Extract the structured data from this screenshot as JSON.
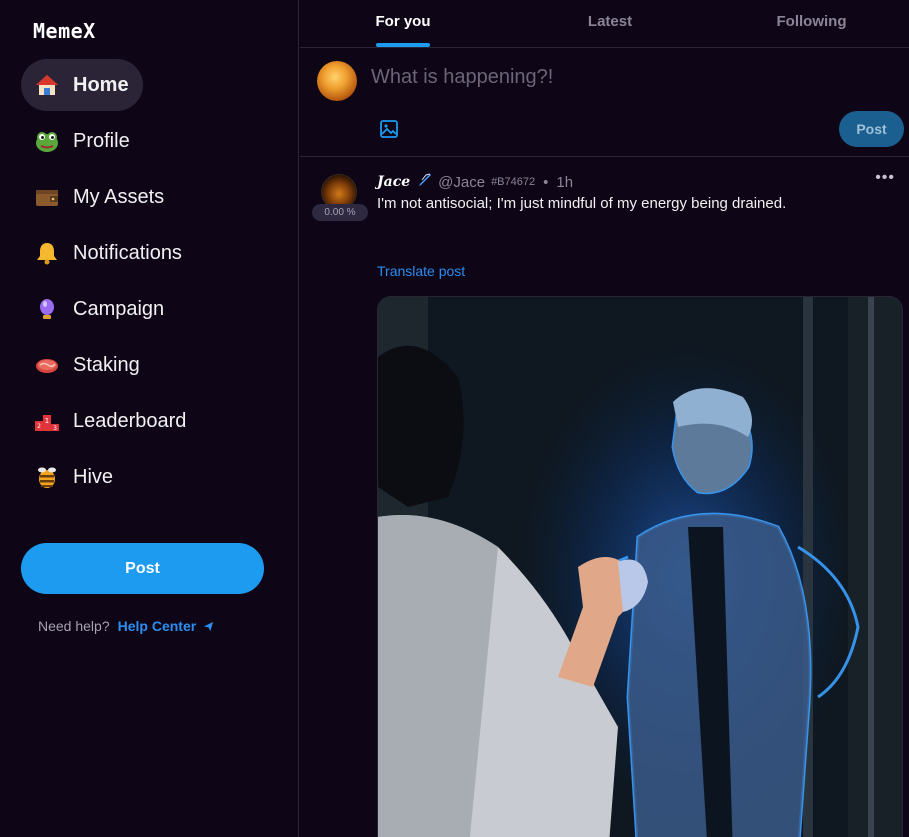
{
  "app": {
    "logo": "MemeX"
  },
  "sidebar": {
    "items": [
      {
        "label": "Home",
        "icon": "house-icon",
        "active": true
      },
      {
        "label": "Profile",
        "icon": "frog-icon"
      },
      {
        "label": "My Assets",
        "icon": "wallet-icon"
      },
      {
        "label": "Notifications",
        "icon": "bell-icon"
      },
      {
        "label": "Campaign",
        "icon": "crystal-icon"
      },
      {
        "label": "Staking",
        "icon": "steak-icon"
      },
      {
        "label": "Leaderboard",
        "icon": "podium-icon"
      },
      {
        "label": "Hive",
        "icon": "bee-icon"
      }
    ],
    "post_label": "Post",
    "help_question": "Need help?",
    "help_link": "Help Center"
  },
  "tabs": [
    {
      "label": "For you",
      "active": true
    },
    {
      "label": "Latest"
    },
    {
      "label": "Following"
    }
  ],
  "composer": {
    "placeholder": "What is happening?!",
    "post_label": "Post"
  },
  "post": {
    "name": "Jace",
    "handle": "@Jace",
    "hash": "#B74672",
    "separator": "•",
    "time": "1h",
    "percent": "0.00 %",
    "text": "I'm not antisocial; I'm just mindful of my energy being drained.",
    "translate_label": "Translate post",
    "more_label": "•••"
  },
  "colors": {
    "background": "#0e0517",
    "accent": "#1d9bf0",
    "link": "#2b8ef0",
    "active_nav": "#2a2436"
  }
}
